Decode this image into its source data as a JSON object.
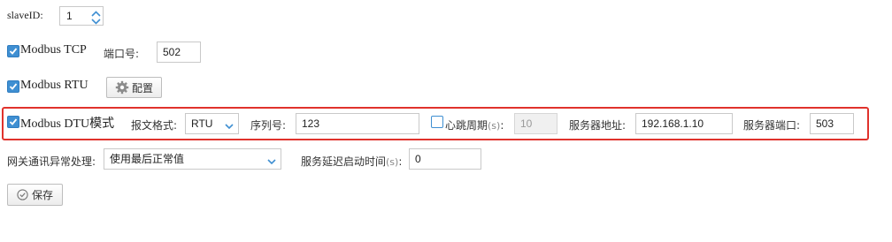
{
  "slave": {
    "label": "slaveID:",
    "value": "1"
  },
  "modbus_tcp": {
    "label": "Modbus TCP",
    "checked": true,
    "port_label": "端口号:",
    "port_value": "502"
  },
  "modbus_rtu": {
    "label": "Modbus RTU",
    "checked": true,
    "config_button": "配置"
  },
  "dtu": {
    "label": "Modbus DTU模式",
    "checked": true,
    "format_label": "报文格式:",
    "format_value": "RTU",
    "serial_label": "序列号:",
    "serial_value": "123",
    "heartbeat_label": "心跳周期",
    "heartbeat_unit": "(s)",
    "heartbeat_sep": ":",
    "heartbeat_checked": false,
    "heartbeat_value": "10",
    "server_addr_label": "服务器地址:",
    "server_addr_value": "192.168.1.10",
    "server_port_label": "服务器端口:",
    "server_port_value": "503"
  },
  "gateway": {
    "label": "网关通讯异常处理:",
    "value": "使用最后正常值"
  },
  "delay": {
    "label": "服务延迟启动时间",
    "unit": "(s)",
    "sep": ":",
    "value": "0"
  },
  "save_button": "保存",
  "colors": {
    "accent": "#3f8fd2",
    "highlight": "#e0322c"
  }
}
